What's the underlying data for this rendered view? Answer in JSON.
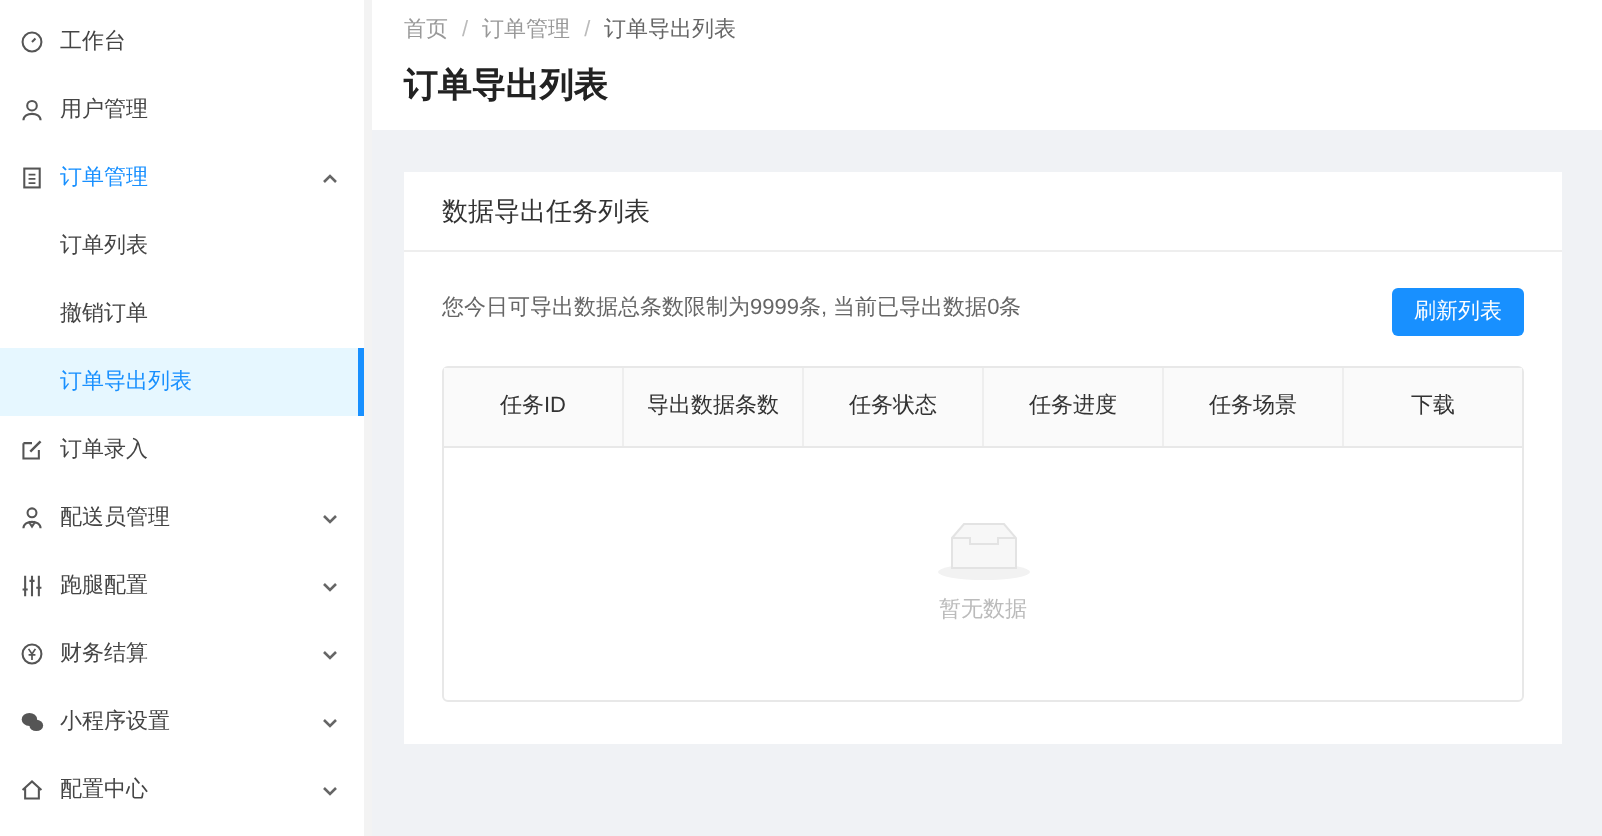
{
  "sidebar": {
    "items": [
      {
        "label": "工作台",
        "selected": false
      },
      {
        "label": "用户管理",
        "selected": false
      },
      {
        "label": "订单管理",
        "selected": false,
        "expanded": true,
        "children": [
          {
            "label": "订单列表",
            "selected": false
          },
          {
            "label": "撤销订单",
            "selected": false
          },
          {
            "label": "订单导出列表",
            "selected": true
          }
        ]
      },
      {
        "label": "订单录入",
        "selected": false
      },
      {
        "label": "配送员管理",
        "selected": false,
        "expanded": false
      },
      {
        "label": "跑腿配置",
        "selected": false,
        "expanded": false
      },
      {
        "label": "财务结算",
        "selected": false,
        "expanded": false
      },
      {
        "label": "小程序设置",
        "selected": false,
        "expanded": false
      },
      {
        "label": "配置中心",
        "selected": false,
        "expanded": false
      }
    ]
  },
  "breadcrumb": {
    "separator": "/",
    "items": [
      "首页",
      "订单管理",
      "订单导出列表"
    ]
  },
  "page_title": "订单导出列表",
  "card": {
    "title": "数据导出任务列表",
    "notice": "您今日可导出数据总条数限制为9999条, 当前已导出数据0条",
    "refresh_button": "刷新列表",
    "table": {
      "columns": [
        "任务ID",
        "导出数据条数",
        "任务状态",
        "任务进度",
        "任务场景",
        "下载"
      ],
      "empty_text": "暂无数据"
    }
  }
}
